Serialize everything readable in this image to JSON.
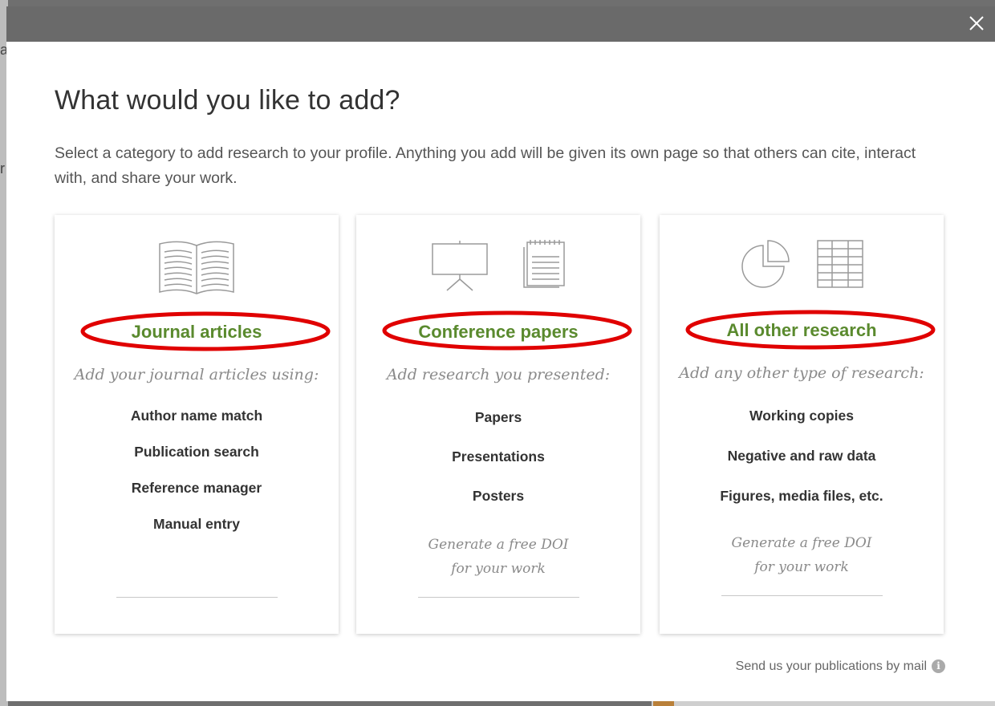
{
  "modal": {
    "title": "What would you like to add?",
    "intro": "Select a category to add research to your profile. Anything you add will be given its own page so that others can cite, interact with, and share your work."
  },
  "cards": [
    {
      "title": "Journal articles",
      "subtitle": "Add your journal articles using:",
      "items": [
        "Author name match",
        "Publication search",
        "Reference manager",
        "Manual entry"
      ],
      "icons": [
        "open-book-icon"
      ]
    },
    {
      "title": "Conference papers",
      "subtitle": "Add research you presented:",
      "items": [
        "Papers",
        "Presentations",
        "Posters"
      ],
      "doi_line1": "Generate a free DOI",
      "doi_line2": "for your work",
      "icons": [
        "presentation-board-icon",
        "notepad-icon"
      ]
    },
    {
      "title": "All other research",
      "subtitle": "Add any other type of research:",
      "items": [
        "Working copies",
        "Negative and raw data",
        "Figures, media files, etc."
      ],
      "doi_line1": "Generate a free DOI",
      "doi_line2": "for your work",
      "icons": [
        "pie-chart-icon",
        "grid-table-icon"
      ]
    }
  ],
  "footer": {
    "mail_link": "Send us your publications by mail",
    "info_icon_glyph": "i"
  },
  "colors": {
    "accent_green": "#5a8a2e",
    "annotation_red": "#e00000",
    "overlay": "#6a6a6a"
  }
}
